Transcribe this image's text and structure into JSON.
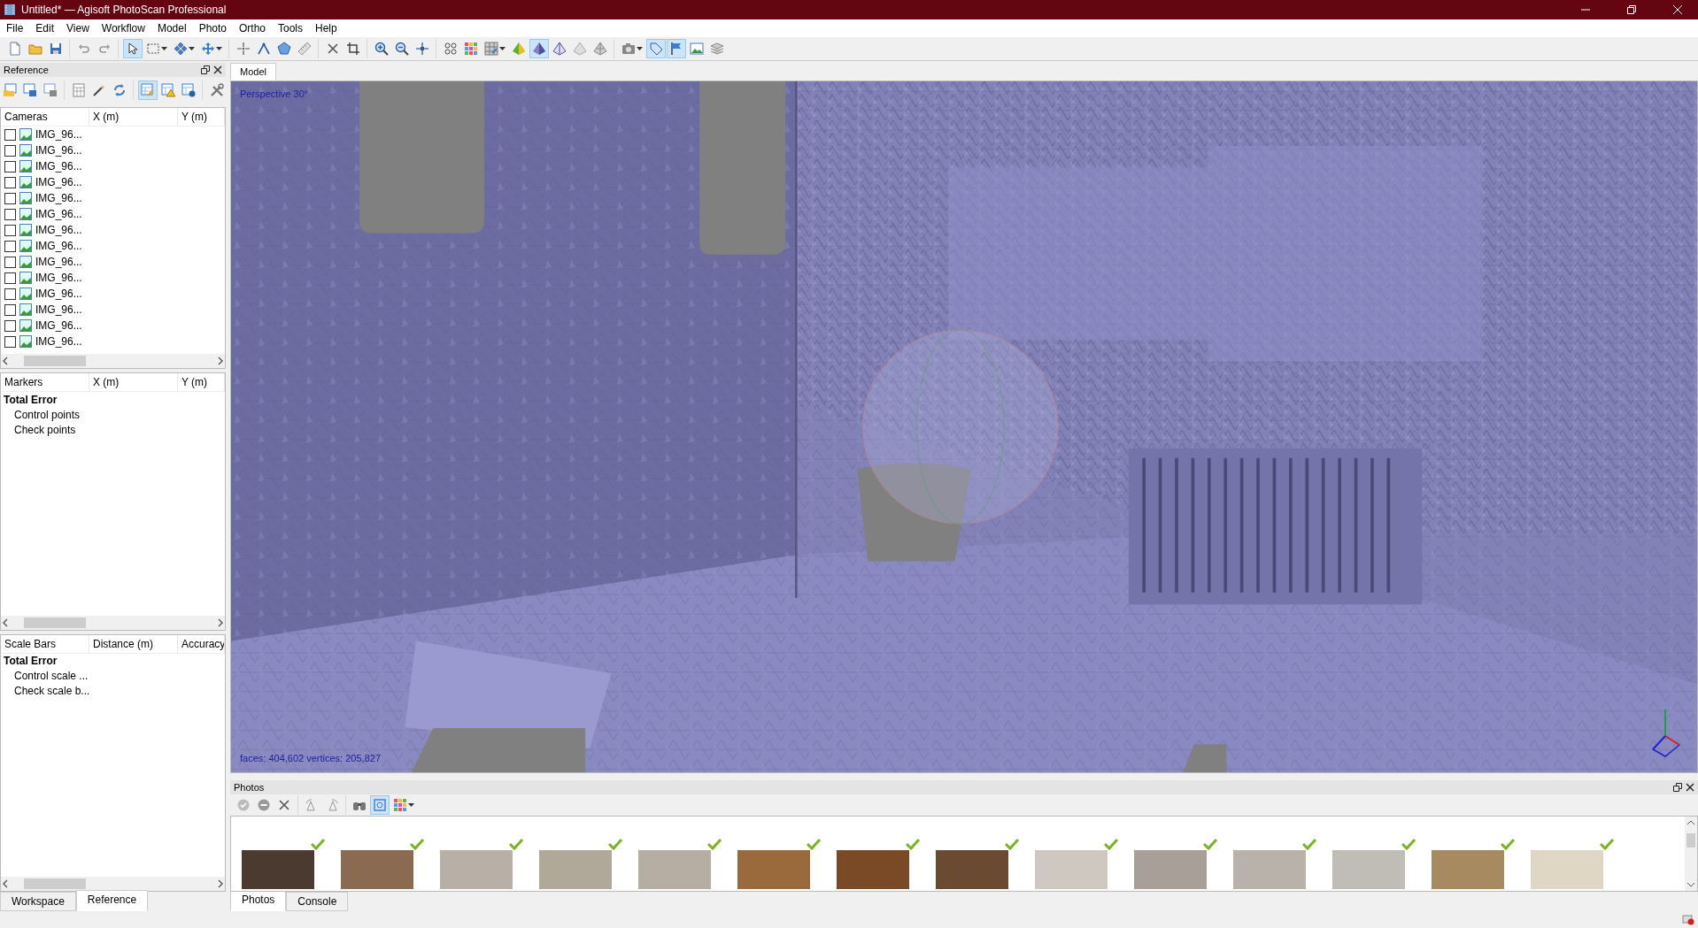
{
  "window": {
    "title": "Untitled* — Agisoft PhotoScan Professional"
  },
  "menu": [
    "File",
    "Edit",
    "View",
    "Workflow",
    "Model",
    "Photo",
    "Ortho",
    "Tools",
    "Help"
  ],
  "toolbar": [
    [
      {
        "kind": "new",
        "pressed": false,
        "dropdown": false
      },
      {
        "kind": "open",
        "pressed": false,
        "dropdown": false
      },
      {
        "kind": "save",
        "pressed": false,
        "dropdown": false
      }
    ],
    [
      {
        "kind": "undo",
        "pressed": false,
        "dropdown": false
      },
      {
        "kind": "redo",
        "pressed": false,
        "dropdown": false
      }
    ],
    [
      {
        "kind": "select",
        "pressed": true,
        "dropdown": false
      },
      {
        "kind": "rect",
        "pressed": false,
        "dropdown": true
      },
      {
        "kind": "navigate",
        "pressed": false,
        "dropdown": true
      },
      {
        "kind": "move",
        "pressed": false,
        "dropdown": true
      }
    ],
    [
      {
        "kind": "point",
        "pressed": false,
        "dropdown": false
      },
      {
        "kind": "angle",
        "pressed": false,
        "dropdown": false
      },
      {
        "kind": "polygon",
        "pressed": false,
        "dropdown": false
      },
      {
        "kind": "ruler",
        "pressed": false,
        "dropdown": false
      }
    ],
    [
      {
        "kind": "delete",
        "pressed": false,
        "dropdown": false
      },
      {
        "kind": "crop",
        "pressed": false,
        "dropdown": false
      }
    ],
    [
      {
        "kind": "zoomin",
        "pressed": false,
        "dropdown": false
      },
      {
        "kind": "zoomout",
        "pressed": false,
        "dropdown": false
      },
      {
        "kind": "fit",
        "pressed": false,
        "dropdown": false
      }
    ],
    [
      {
        "kind": "dots",
        "pressed": false,
        "dropdown": false
      },
      {
        "kind": "colorgrid",
        "pressed": false,
        "dropdown": false
      },
      {
        "kind": "texgrid",
        "pressed": false,
        "dropdown": true
      },
      {
        "kind": "pyrsolid",
        "pressed": false,
        "dropdown": false
      },
      {
        "kind": "pyrshaded",
        "pressed": true,
        "dropdown": false
      },
      {
        "kind": "pyrwire",
        "pressed": false,
        "dropdown": false
      },
      {
        "kind": "pyrgrey",
        "pressed": false,
        "dropdown": false
      },
      {
        "kind": "pyrtex",
        "pressed": false,
        "dropdown": false
      }
    ],
    [
      {
        "kind": "camera",
        "pressed": false,
        "dropdown": true
      },
      {
        "kind": "tag",
        "pressed": true,
        "dropdown": false
      },
      {
        "kind": "flag",
        "pressed": true,
        "dropdown": false
      },
      {
        "kind": "image",
        "pressed": false,
        "dropdown": false
      },
      {
        "kind": "stack",
        "pressed": false,
        "dropdown": false
      }
    ]
  ],
  "reference_panel": {
    "title": "Reference",
    "toolbar": [
      [
        {
          "kind": "import",
          "pressed": false,
          "dropdown": false
        },
        {
          "kind": "export",
          "pressed": false,
          "dropdown": false
        },
        {
          "kind": "exportgrey",
          "pressed": false,
          "dropdown": false
        }
      ],
      [
        {
          "kind": "calc",
          "pressed": false,
          "dropdown": false
        },
        {
          "kind": "wand",
          "pressed": false,
          "dropdown": false
        },
        {
          "kind": "convert",
          "pressed": false,
          "dropdown": false
        }
      ],
      [
        {
          "kind": "tablepen",
          "pressed": true,
          "dropdown": false
        },
        {
          "kind": "tablewarn",
          "pressed": false,
          "dropdown": false
        },
        {
          "kind": "tableinfo",
          "pressed": false,
          "dropdown": false
        }
      ],
      [
        {
          "kind": "tools",
          "pressed": false,
          "dropdown": false
        }
      ]
    ],
    "cameras": {
      "columns": [
        "Cameras",
        "X (m)",
        "Y (m)"
      ],
      "rows": [
        {
          "label": "IMG_96...",
          "checked": false
        },
        {
          "label": "IMG_96...",
          "checked": false
        },
        {
          "label": "IMG_96...",
          "checked": false
        },
        {
          "label": "IMG_96...",
          "checked": false
        },
        {
          "label": "IMG_96...",
          "checked": false
        },
        {
          "label": "IMG_96...",
          "checked": false
        },
        {
          "label": "IMG_96...",
          "checked": false
        },
        {
          "label": "IMG_96...",
          "checked": false
        },
        {
          "label": "IMG_96...",
          "checked": false
        },
        {
          "label": "IMG_96...",
          "checked": false
        },
        {
          "label": "IMG_96...",
          "checked": false
        },
        {
          "label": "IMG_96...",
          "checked": false
        },
        {
          "label": "IMG_96...",
          "checked": false
        },
        {
          "label": "IMG_96...",
          "checked": false
        }
      ]
    },
    "markers": {
      "columns": [
        "Markers",
        "X (m)",
        "Y (m)"
      ],
      "rows": [
        {
          "label": "Total Error",
          "kind": "total"
        },
        {
          "label": "Control points",
          "kind": "child"
        },
        {
          "label": "Check points",
          "kind": "child"
        }
      ]
    },
    "scale_bars": {
      "columns": [
        "Scale Bars",
        "Distance (m)",
        "Accuracy"
      ],
      "rows": [
        {
          "label": "Total Error",
          "kind": "total"
        },
        {
          "label": "Control scale ...",
          "kind": "child"
        },
        {
          "label": "Check scale b...",
          "kind": "child"
        }
      ]
    }
  },
  "left_tabs": [
    {
      "label": "Workspace",
      "selected": false
    },
    {
      "label": "Reference",
      "selected": true
    }
  ],
  "view_tabs": [
    {
      "label": "Model",
      "selected": true
    }
  ],
  "viewport": {
    "projection": "Perspective 30°",
    "stats": "faces: 404,602 vertices: 205,827"
  },
  "photos_panel": {
    "title": "Photos",
    "toolbar": [
      [
        {
          "kind": "enable",
          "pressed": false,
          "dropdown": false
        },
        {
          "kind": "disable",
          "pressed": false,
          "dropdown": false
        },
        {
          "kind": "delete",
          "pressed": false,
          "dropdown": false
        }
      ],
      [
        {
          "kind": "rotl",
          "pressed": false,
          "dropdown": false
        },
        {
          "kind": "rotr",
          "pressed": false,
          "dropdown": false
        }
      ],
      [
        {
          "kind": "binoculars",
          "pressed": false,
          "dropdown": false
        },
        {
          "kind": "filter",
          "pressed": true,
          "dropdown": false
        },
        {
          "kind": "colorgrid",
          "pressed": false,
          "dropdown": true
        }
      ]
    ],
    "photos": [
      {
        "aligned": true
      },
      {
        "aligned": true
      },
      {
        "aligned": true
      },
      {
        "aligned": true
      },
      {
        "aligned": true
      },
      {
        "aligned": true
      },
      {
        "aligned": true
      },
      {
        "aligned": true
      },
      {
        "aligned": true
      },
      {
        "aligned": true
      },
      {
        "aligned": true
      },
      {
        "aligned": true
      },
      {
        "aligned": true
      },
      {
        "aligned": true
      }
    ]
  },
  "bottom_tabs": [
    {
      "label": "Photos",
      "selected": true
    },
    {
      "label": "Console",
      "selected": false
    }
  ]
}
